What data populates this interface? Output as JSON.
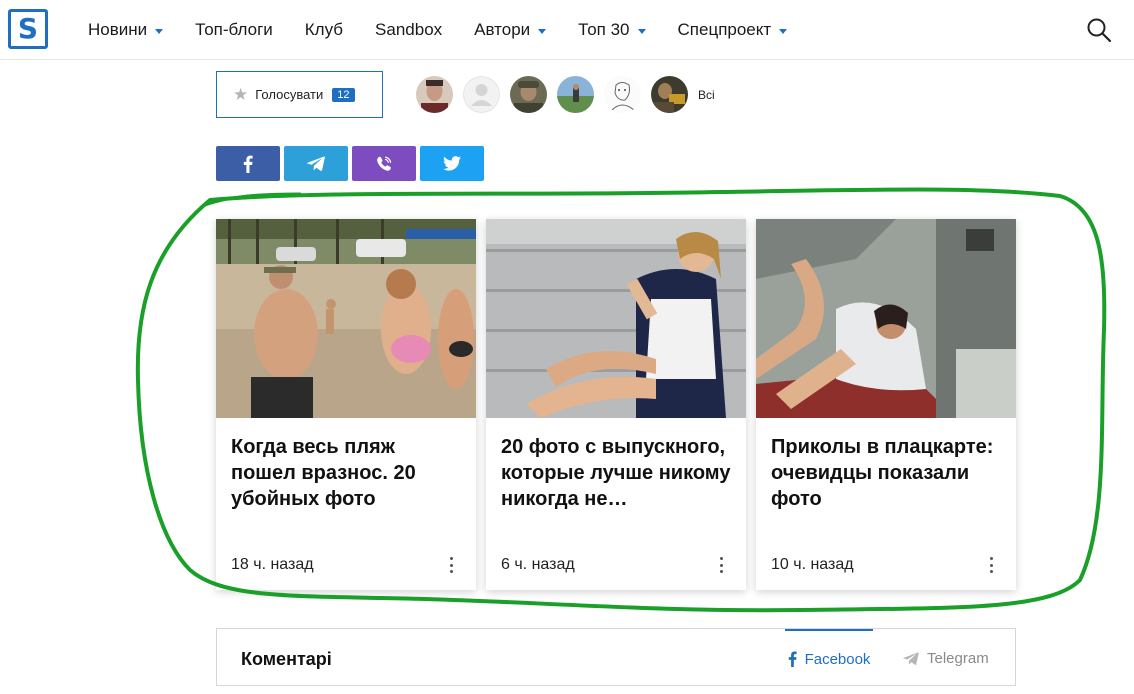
{
  "header": {
    "logo_letter": "S",
    "nav": [
      {
        "label": "Новини",
        "dropdown": true
      },
      {
        "label": "Топ-блоги",
        "dropdown": false
      },
      {
        "label": "Клуб",
        "dropdown": false
      },
      {
        "label": "Sandbox",
        "dropdown": false
      },
      {
        "label": "Автори",
        "dropdown": true
      },
      {
        "label": "Топ 30",
        "dropdown": true
      },
      {
        "label": "Спецпроект",
        "dropdown": true
      }
    ],
    "search_icon": "search-icon"
  },
  "vote": {
    "label": "Голосувати",
    "count": "12"
  },
  "voters": {
    "all_label": "Всі"
  },
  "share": {
    "buttons": [
      "facebook",
      "telegram",
      "viber",
      "twitter"
    ]
  },
  "cards": [
    {
      "title": "Когда весь пляж пошел вразнос. 20 убойных фото",
      "time": "18 ч. назад"
    },
    {
      "title": "20 фото с выпускного, которые лучше никому никогда не…",
      "time": "6 ч. назад"
    },
    {
      "title": "Приколы в плацкарте: очевидцы показали фото",
      "time": "10 ч. назад"
    }
  ],
  "comments": {
    "title": "Коментарі",
    "tabs": [
      {
        "label": "Facebook",
        "active": true
      },
      {
        "label": "Telegram",
        "active": false
      }
    ]
  },
  "colors": {
    "brand": "#1e6fc2",
    "facebook": "#3b5ea6",
    "telegram": "#2d9fd9",
    "viber": "#7d4cbf",
    "twitter": "#1da1f2",
    "annotation": "#1aa028"
  }
}
